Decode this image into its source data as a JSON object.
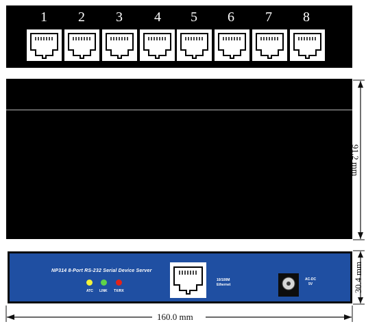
{
  "rear_panel": {
    "port_numbers": [
      "1",
      "2",
      "3",
      "4",
      "5",
      "6",
      "7",
      "8"
    ]
  },
  "front_panel": {
    "title": "NP314  8-Port RS-232 Serial Device Server",
    "leds": [
      {
        "label": "ATC",
        "color": "#f2f23a"
      },
      {
        "label": "LINK",
        "color": "#5fd34a"
      },
      {
        "label": "TX/RX",
        "color": "#e2231a"
      }
    ],
    "ethernet_label_line1": "10/100M",
    "ethernet_label_line2": "Ethernet",
    "power_label_line1": "AC-DC",
    "power_label_line2": "5V",
    "body_color": "#1f4fa2"
  },
  "dimensions": {
    "width": "160.0 mm",
    "depth": "91.2 mm",
    "height": "30.4 mm"
  }
}
